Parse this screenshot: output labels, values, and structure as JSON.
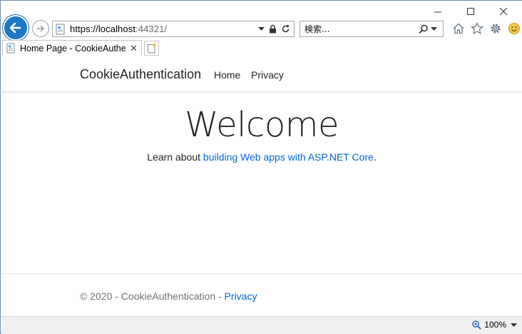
{
  "browser": {
    "address": {
      "host": "https://localhost",
      "rest": ":44321/"
    },
    "search": {
      "placeholder": "検索..."
    },
    "tab": {
      "title": "Home Page - CookieAuthe...",
      "close_glyph": "✕"
    }
  },
  "site": {
    "brand": "CookieAuthentication",
    "nav": [
      {
        "label": "Home"
      },
      {
        "label": "Privacy"
      }
    ],
    "heading": "Welcome",
    "lead": {
      "prefix": "Learn about ",
      "link_text": "building Web apps with ASP.NET Core",
      "suffix": "."
    },
    "footer": {
      "text": "© 2020 - CookieAuthentication - ",
      "link_text": "Privacy"
    }
  },
  "status": {
    "zoom": "100%"
  },
  "colors": {
    "accent": "#1c78c8",
    "link": "#0366d6",
    "muted": "#6c757d"
  },
  "icons": {
    "back": "back-arrow-icon",
    "forward": "forward-arrow-icon",
    "lock": "lock-icon",
    "refresh": "refresh-icon",
    "search": "search-icon",
    "home": "home-icon",
    "favorites": "star-icon",
    "settings": "gear-icon",
    "feedback": "smiley-icon"
  }
}
